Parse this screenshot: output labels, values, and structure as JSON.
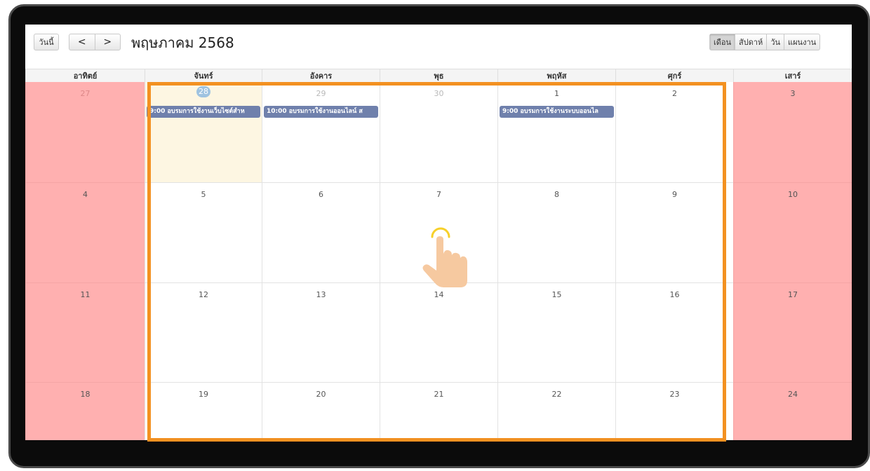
{
  "toolbar": {
    "today_label": "วันนี้",
    "prev_label": "<",
    "next_label": ">",
    "title": "พฤษภาคม 2568",
    "views": [
      {
        "label": "เดือน",
        "active": true
      },
      {
        "label": "สัปดาห์",
        "active": false
      },
      {
        "label": "วัน",
        "active": false
      },
      {
        "label": "แผนงาน",
        "active": false
      }
    ]
  },
  "weekdays": [
    "อาทิตย์",
    "จันทร์",
    "อังคาร",
    "พุธ",
    "พฤหัส",
    "ศุกร์",
    "เสาร์"
  ],
  "weeks": [
    [
      {
        "day": "27",
        "other": true
      },
      {
        "day": "28",
        "other": true,
        "today": true,
        "event": "9:00 อบรมการใช้งานเว็บไซต์สำห"
      },
      {
        "day": "29",
        "other": true,
        "event": "10:00 อบรมการใช้งานออนไลน์ ส"
      },
      {
        "day": "30",
        "other": true
      },
      {
        "day": "1",
        "event": "9:00 อบรมการใช้งานระบบออนไล"
      },
      {
        "day": "2"
      },
      {
        "day": "3"
      }
    ],
    [
      {
        "day": "4"
      },
      {
        "day": "5"
      },
      {
        "day": "6"
      },
      {
        "day": "7"
      },
      {
        "day": "8"
      },
      {
        "day": "9"
      },
      {
        "day": "10"
      }
    ],
    [
      {
        "day": "11"
      },
      {
        "day": "12"
      },
      {
        "day": "13"
      },
      {
        "day": "14"
      },
      {
        "day": "15"
      },
      {
        "day": "16"
      },
      {
        "day": "17"
      }
    ],
    [
      {
        "day": "18"
      },
      {
        "day": "19"
      },
      {
        "day": "20"
      },
      {
        "day": "21"
      },
      {
        "day": "22"
      },
      {
        "day": "23"
      },
      {
        "day": "24"
      }
    ]
  ],
  "colors": {
    "weekend": "#ffb0b0",
    "event": "#6f80ac",
    "today": "#fdf6e2",
    "highlight": "#f39121",
    "hand": "#f6c9a0"
  },
  "icons": {
    "pointer": "tap-hand-icon"
  }
}
